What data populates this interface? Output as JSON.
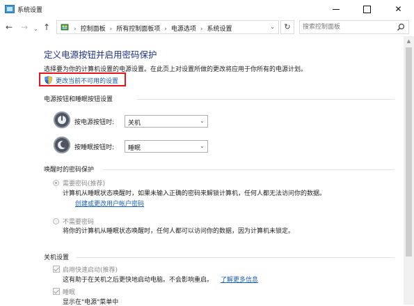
{
  "window": {
    "title": "系统设置"
  },
  "nav": {
    "breadcrumbs": [
      "控制面板",
      "所有控制面板项",
      "电源选项",
      "系统设置"
    ],
    "search_placeholder": "搜索控制面板"
  },
  "page": {
    "title": "定义电源按钮并启用密码保护",
    "intro": "选择要为你的计算机设置的电源设置。在此页上对设置所做的更改将应用于你所有的电源计划。",
    "change_link": "更改当前不可用的设置"
  },
  "buttons_section": {
    "heading": "电源按钮和睡眠按钮设置",
    "power_label": "按电源按钮时:",
    "power_value": "关机",
    "sleep_label": "按睡眠按钮时:",
    "sleep_value": "睡眠"
  },
  "password_section": {
    "heading": "唤醒时的密码保护",
    "require_label": "需要密码(推荐)",
    "require_desc": "计算机从睡眠状态唤醒时，如果未输入正确的密码来解锁计算机，任何人都无法访问你的数据。",
    "create_link": "创建或更改用户帐户密码",
    "norequire_label": "不需要密码",
    "norequire_desc": "将你的计算机从睡眠状态唤醒时，任何人都可以访问你的数据，因为计算机未锁定。"
  },
  "shutdown_section": {
    "heading": "关机设置",
    "fast_label": "启用快速启动(推荐)",
    "fast_desc": "这有助于在关机之后更快地启动电脑。不会影响重启。",
    "learn_more": "了解更多信息",
    "sleep_label": "睡眠",
    "sleep_desc": "显示在\"电源\"菜单中"
  },
  "colors": {
    "title": "#1e3287",
    "link": "#1a5fb4",
    "highlight_border": "#e8141b"
  }
}
